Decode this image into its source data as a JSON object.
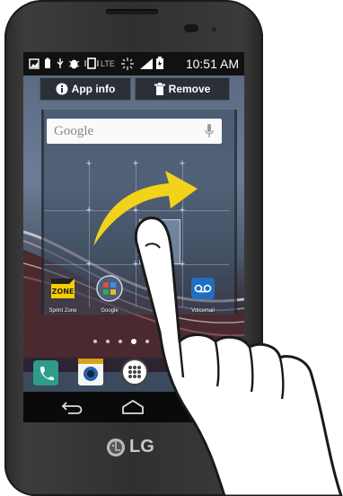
{
  "status_bar": {
    "network_label": "LTE",
    "time": "10:51 AM"
  },
  "top_actions": {
    "app_info_label": "App info",
    "remove_label": "Remove"
  },
  "search": {
    "placeholder": "Google"
  },
  "apps": [
    {
      "label": "Sprint Zone",
      "icon": "sprint-zone-icon",
      "icon_text": "ZONE"
    },
    {
      "label": "Google",
      "icon": "google-folder-icon"
    },
    {
      "label": "Voicemail",
      "icon": "voicemail-icon"
    }
  ],
  "dock": [
    {
      "name": "phone-icon"
    },
    {
      "name": "camera-icon"
    },
    {
      "name": "apps-drawer-icon"
    }
  ],
  "brand": {
    "logo_text": "LG"
  },
  "colors": {
    "arrow": "#f2d21a",
    "screen_bg": "#3b4a5c",
    "phone_body": "#333333"
  }
}
